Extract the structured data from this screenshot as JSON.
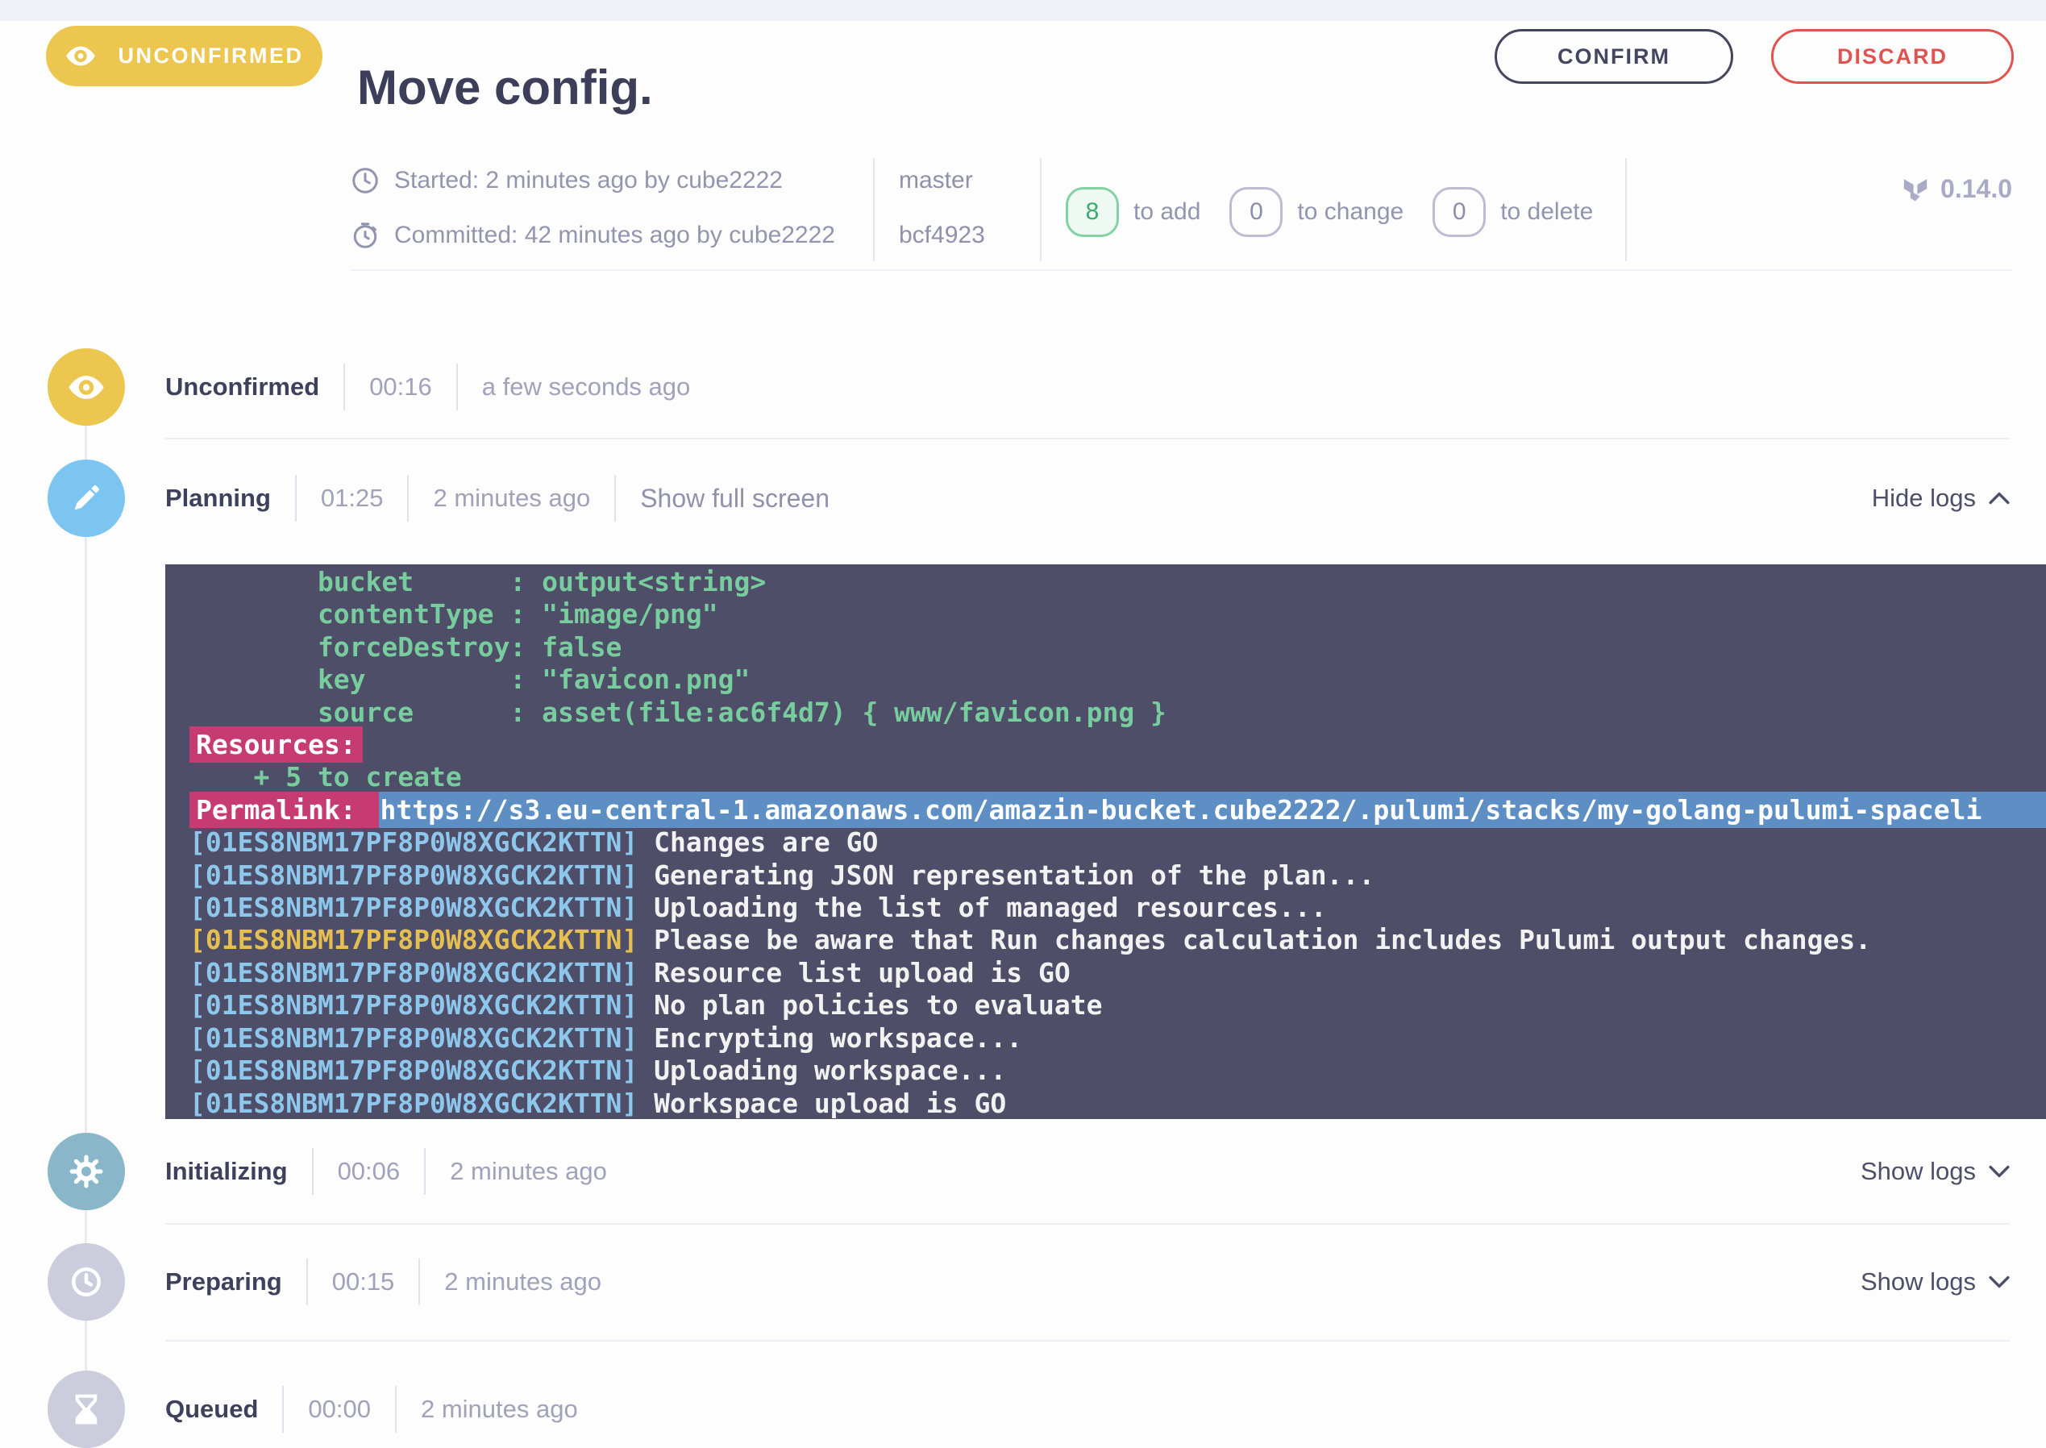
{
  "header": {
    "status_badge": "UNCONFIRMED",
    "title": "Move config.",
    "confirm_label": "CONFIRM",
    "discard_label": "DISCARD"
  },
  "meta": {
    "started": "Started: 2 minutes ago by cube2222",
    "committed": "Committed: 42 minutes ago by cube2222",
    "branch": "master",
    "commit": "bcf4923",
    "changes": [
      {
        "count": "8",
        "label": "to add"
      },
      {
        "count": "0",
        "label": "to change"
      },
      {
        "count": "0",
        "label": "to delete"
      }
    ],
    "version": "0.14.0"
  },
  "stages": [
    {
      "name": "Unconfirmed",
      "duration": "00:16",
      "ago": "a few seconds ago",
      "icon": "eye-icon"
    },
    {
      "name": "Planning",
      "duration": "01:25",
      "ago": "2 minutes ago",
      "icon": "pencil-icon",
      "fullscreen_label": "Show full screen",
      "toggle_label": "Hide logs"
    },
    {
      "name": "Initializing",
      "duration": "00:06",
      "ago": "2 minutes ago",
      "icon": "gear-icon",
      "toggle_label": "Show logs"
    },
    {
      "name": "Preparing",
      "duration": "00:15",
      "ago": "2 minutes ago",
      "icon": "clock-icon",
      "toggle_label": "Show logs"
    },
    {
      "name": "Queued",
      "duration": "00:00",
      "ago": "2 minutes ago",
      "icon": "hourglass-icon"
    }
  ],
  "log": {
    "lines": [
      [
        {
          "s": "green",
          "t": "        bucket      : output<string>"
        }
      ],
      [
        {
          "s": "green",
          "t": "        contentType : \"image/png\""
        }
      ],
      [
        {
          "s": "green",
          "t": "        forceDestroy: false"
        }
      ],
      [
        {
          "s": "green",
          "t": "        key         : \"favicon.png\""
        }
      ],
      [
        {
          "s": "green",
          "t": "        source      : asset(file:ac6f4d7) { www/favicon.png }"
        }
      ],
      [
        {
          "s": "pink",
          "t": "Resources:"
        }
      ],
      [
        {
          "s": "green",
          "t": "    + 5 to create"
        }
      ],
      [
        {
          "s": "pink",
          "t": "Permalink: "
        },
        {
          "s": "blue",
          "t": "https://s3.eu-central-1.amazonaws.com/amazin-bucket.cube2222/.pulumi/stacks/my-golang-pulumi-spaceli      "
        }
      ],
      [
        {
          "s": "id",
          "t": "[01ES8NBM17PF8P0W8XGCK2KTTN]"
        },
        {
          "s": "white",
          "t": " Changes are GO"
        }
      ],
      [
        {
          "s": "id",
          "t": "[01ES8NBM17PF8P0W8XGCK2KTTN]"
        },
        {
          "s": "white",
          "t": " Generating JSON representation of the plan..."
        }
      ],
      [
        {
          "s": "id",
          "t": "[01ES8NBM17PF8P0W8XGCK2KTTN]"
        },
        {
          "s": "white",
          "t": " Uploading the list of managed resources..."
        }
      ],
      [
        {
          "s": "warn",
          "t": "[01ES8NBM17PF8P0W8XGCK2KTTN]"
        },
        {
          "s": "white",
          "t": " Please be aware that Run changes calculation includes Pulumi output changes."
        }
      ],
      [
        {
          "s": "id",
          "t": "[01ES8NBM17PF8P0W8XGCK2KTTN]"
        },
        {
          "s": "white",
          "t": " Resource list upload is GO"
        }
      ],
      [
        {
          "s": "id",
          "t": "[01ES8NBM17PF8P0W8XGCK2KTTN]"
        },
        {
          "s": "white",
          "t": " No plan policies to evaluate"
        }
      ],
      [
        {
          "s": "id",
          "t": "[01ES8NBM17PF8P0W8XGCK2KTTN]"
        },
        {
          "s": "white",
          "t": " Encrypting workspace..."
        }
      ],
      [
        {
          "s": "id",
          "t": "[01ES8NBM17PF8P0W8XGCK2KTTN]"
        },
        {
          "s": "white",
          "t": " Uploading workspace..."
        }
      ],
      [
        {
          "s": "id",
          "t": "[01ES8NBM17PF8P0W8XGCK2KTTN]"
        },
        {
          "s": "white",
          "t": " Workspace upload is GO"
        }
      ]
    ]
  },
  "colors": {
    "accent_yellow": "#ecc64f",
    "planning_blue": "#7dc5f1",
    "initializing_blue": "#8ab6c9",
    "idle_gray": "#cbccdc",
    "confirm_navy": "#43465e",
    "discard_red": "#e0534f",
    "add_green": "#3da96c",
    "terminal_bg": "#4f4e68",
    "log_green": "#77cd9d",
    "log_id_blue": "#8ec7ec",
    "log_warn_yellow": "#e5bf51",
    "highlight_pink": "#c53b72",
    "highlight_blue": "#5e8fc4"
  }
}
